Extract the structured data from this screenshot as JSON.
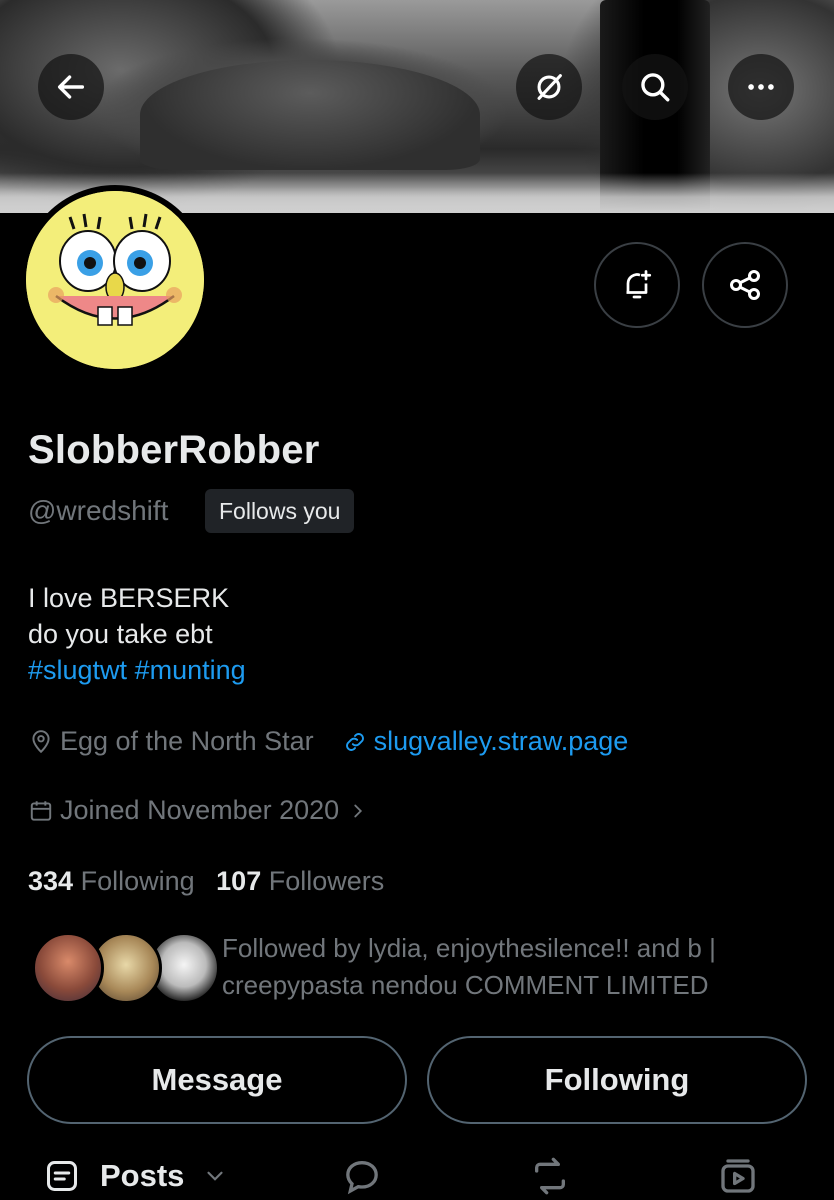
{
  "profile": {
    "display_name": "SlobberRobber",
    "handle": "@wredshift",
    "follows_you": "Follows you",
    "bio_line1": "I love BERSERK",
    "bio_line2": "do you take ebt",
    "hashtags": [
      "#slugtwt",
      "#munting"
    ],
    "location": "Egg of the North Star",
    "website": "slugvalley.straw.page",
    "joined": "Joined November 2020",
    "following_count": "334",
    "following_label": "Following",
    "followers_count": "107",
    "followers_label": "Followers",
    "followed_by": "Followed by lydia, enjoythesilence!! and b | creepypasta nendou COMMENT LIMITED"
  },
  "actions": {
    "message": "Message",
    "following": "Following"
  },
  "tabs": {
    "posts": "Posts"
  },
  "colors": {
    "background": "#000000",
    "accent": "#1d9bf0",
    "muted": "#71767b",
    "text": "#e7e9ea"
  },
  "icons": [
    "back-arrow-icon",
    "grok-icon",
    "search-icon",
    "more-icon",
    "bell-plus-icon",
    "share-icon",
    "location-icon",
    "link-icon",
    "calendar-icon",
    "chevron-right-icon",
    "posts-icon",
    "chevron-down-icon",
    "reply-icon",
    "repost-icon",
    "media-icon"
  ]
}
